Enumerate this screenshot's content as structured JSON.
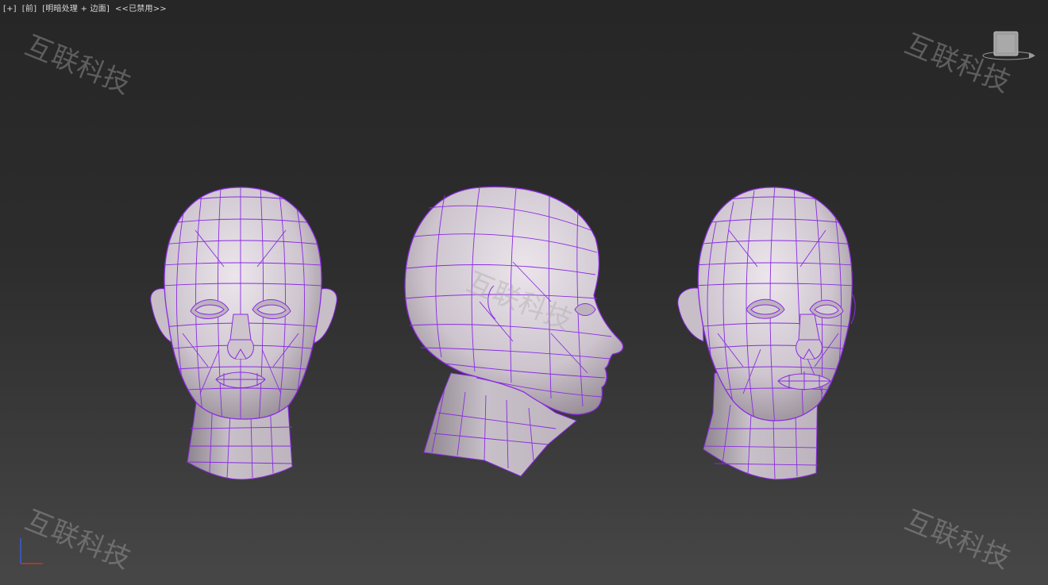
{
  "viewport": {
    "labels": [
      "[+]",
      "[前]",
      "[明暗处理 + 边面]",
      "<<已禁用>>"
    ]
  },
  "watermark": {
    "text": "互联科技"
  },
  "colors": {
    "background_top": "#262626",
    "background_bottom": "#474747",
    "wireframe": "#8a2be2",
    "mesh_surface": "#d4ccd4",
    "axis_x": "#c0392b",
    "axis_y": "#3a5bd9"
  },
  "scene": {
    "objects": [
      "head-front",
      "head-side",
      "head-three-quarter"
    ]
  }
}
